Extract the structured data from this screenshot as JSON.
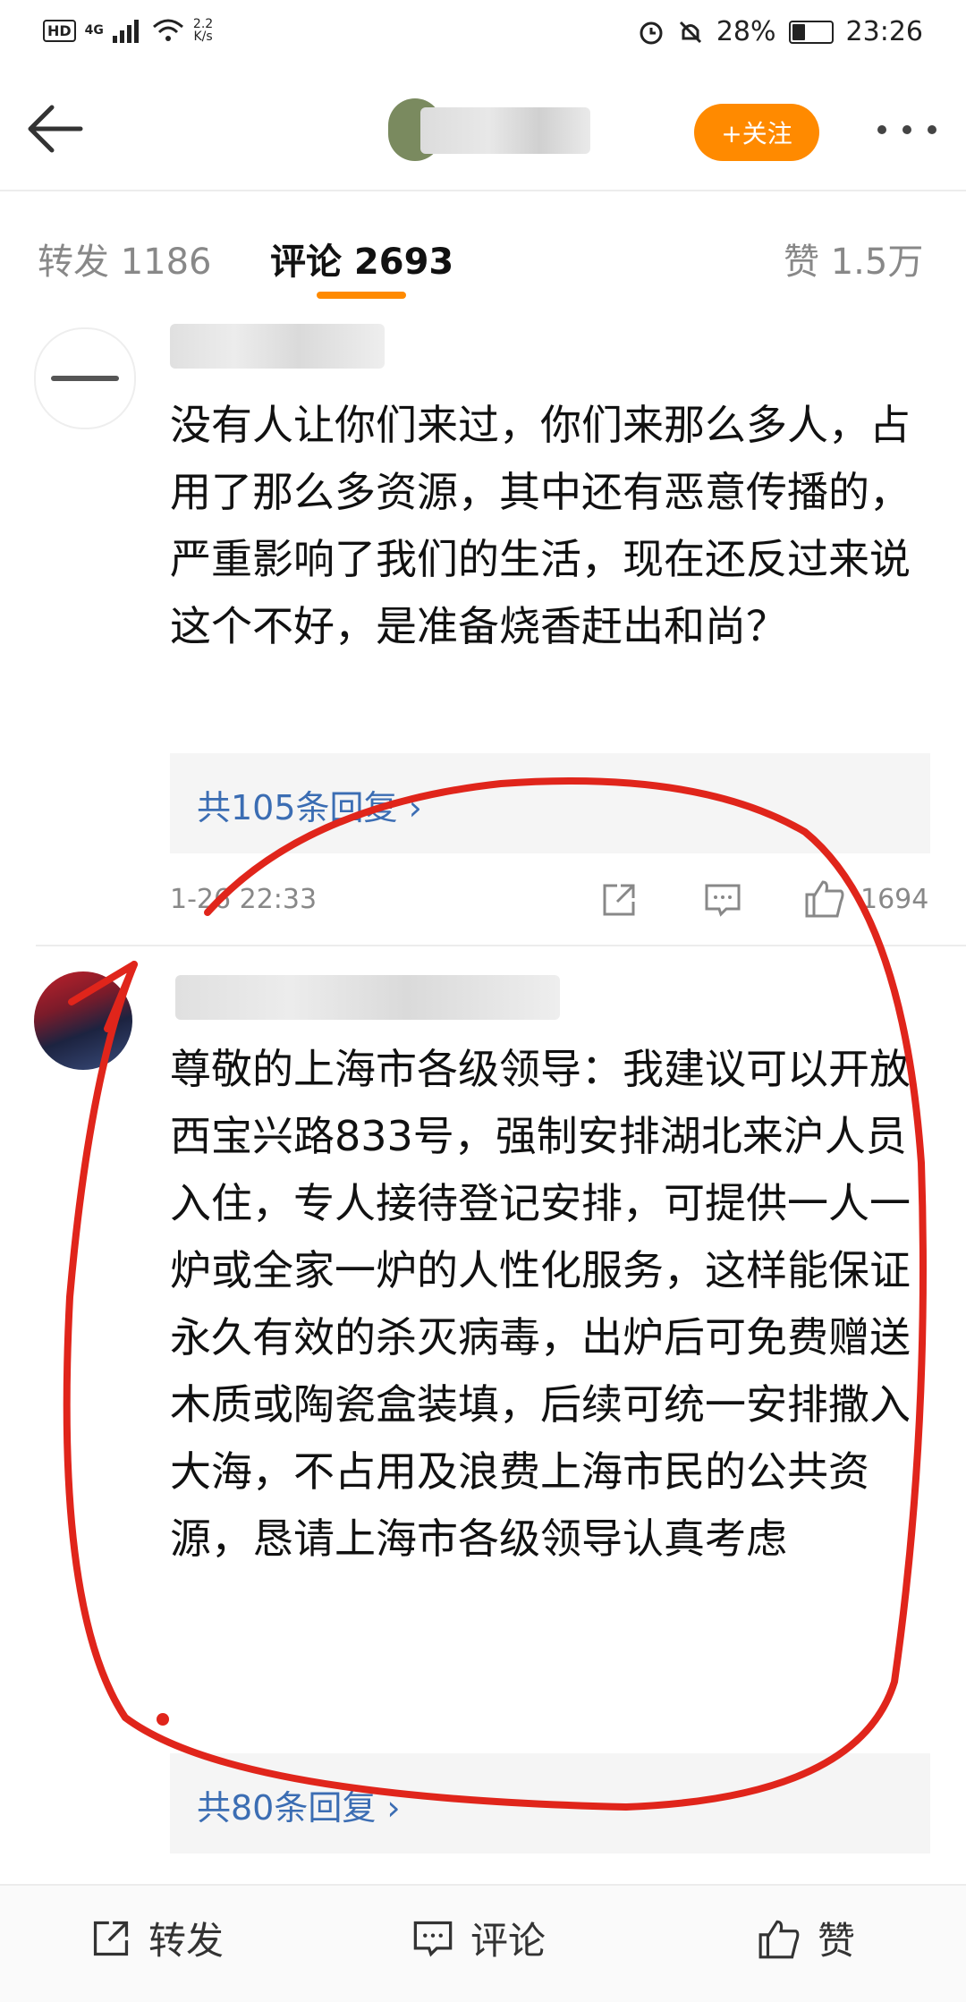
{
  "status_bar": {
    "hd": "HD",
    "signal": "4G",
    "net_speed_top": "2.2",
    "net_speed_bottom": "K/s",
    "battery": "28%",
    "time": "23:26"
  },
  "header": {
    "follow_label": "+关注"
  },
  "tabs": [
    {
      "label": "转发 1186"
    },
    {
      "label": "评论 2693"
    },
    {
      "label": "赞 1.5万"
    }
  ],
  "comments": [
    {
      "text": "没有人让你们来过，你们来那么多人，占用了那么多资源，其中还有恶意传播的，严重影响了我们的生活，现在还反过来说这个不好，是准备烧香赶出和尚？",
      "replies": "共105条回复 ›",
      "time": "1-26 22:33",
      "likes": "1694"
    },
    {
      "text": "尊敬的上海市各级领导：我建议可以开放西宝兴路833号，强制安排湖北来沪人员入住，专人接待登记安排，可提供一人一炉或全家一炉的人性化服务，这样能保证永久有效的杀灭病毒，出炉后可免费赠送木质或陶瓷盒装填，后续可统一安排撒入大海，不占用及浪费上海市民的公共资源，恳请上海市各级领导认真考虑",
      "replies": "共80条回复 ›"
    }
  ],
  "bottom_bar": {
    "repost": "转发",
    "comment": "评论",
    "like": "赞"
  },
  "colors": {
    "accent": "#ff8a00",
    "link": "#3b6db3",
    "annotation": "#e0251b"
  }
}
